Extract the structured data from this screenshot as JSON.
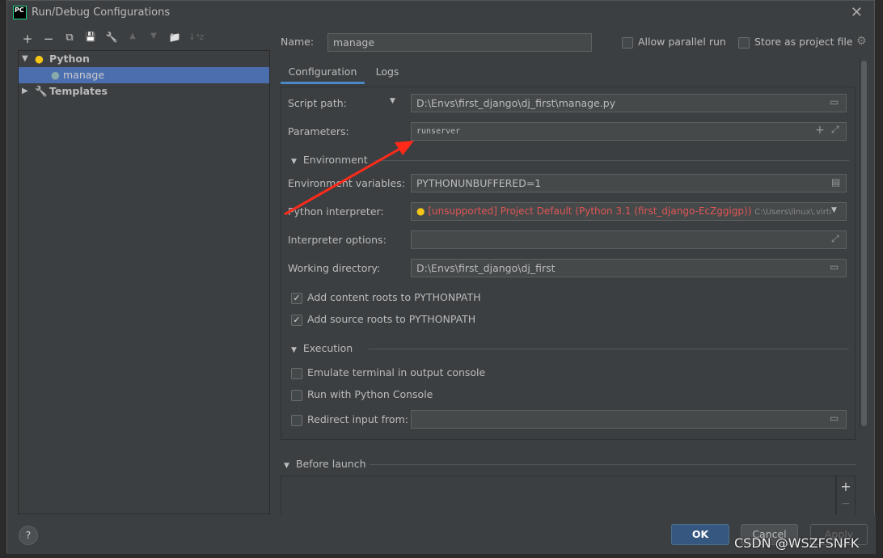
{
  "window": {
    "title": "Run/Debug Configurations",
    "logo_text": "PC"
  },
  "toolbar": {
    "add": "+",
    "remove": "−",
    "copy": "⧉",
    "save": "💾",
    "edit": "🔧",
    "up": "▲",
    "down": "▼",
    "folder": "📁",
    "sort": "↓ᵃz"
  },
  "tree": {
    "items": [
      {
        "label": "Python",
        "expanded": true
      },
      {
        "label": "manage",
        "selected": true
      },
      {
        "label": "Templates",
        "expanded": false
      }
    ]
  },
  "name": {
    "label": "Name:",
    "value": "manage"
  },
  "allow_parallel": {
    "label": "Allow parallel run",
    "checked": false
  },
  "store_project": {
    "label": "Store as project file",
    "checked": false
  },
  "tabs": [
    {
      "label": "Configuration",
      "active": true
    },
    {
      "label": "Logs",
      "active": false
    }
  ],
  "form": {
    "script_path": {
      "label": "Script path:",
      "value": "D:\\Envs\\first_django\\dj_first\\manage.py"
    },
    "parameters": {
      "label": "Parameters:",
      "value": "runserver"
    },
    "environment_section": "Environment",
    "env_vars": {
      "label": "Environment variables:",
      "value": "PYTHONUNBUFFERED=1"
    },
    "interpreter": {
      "label": "Python interpreter:",
      "value": "[unsupported] Project Default (Python 3.1 (first_django-EcZggigp))",
      "path": "C:\\Users\\linux\\.virtu"
    },
    "interp_options": {
      "label": "Interpreter options:",
      "value": ""
    },
    "working_dir": {
      "label": "Working directory:",
      "value": "D:\\Envs\\first_django\\dj_first"
    },
    "content_roots": {
      "label": "Add content roots to PYTHONPATH",
      "checked": true
    },
    "source_roots": {
      "label": "Add source roots to PYTHONPATH",
      "checked": true
    },
    "execution_section": "Execution",
    "emulate_terminal": {
      "label": "Emulate terminal in output console",
      "checked": false
    },
    "python_console": {
      "label": "Run with Python Console",
      "checked": false
    },
    "redirect_input": {
      "label": "Redirect input from:",
      "checked": false,
      "value": ""
    }
  },
  "before_launch": {
    "label": "Before launch",
    "add": "+",
    "remove": "−"
  },
  "buttons": {
    "help": "?",
    "ok": "OK",
    "cancel": "Cancel",
    "apply": "Apply"
  },
  "watermark": "CSDN @WSZFSNFK",
  "colors": {
    "accent": "#4b6eaf",
    "error": "#e05555",
    "arrow": "#ff2a1a"
  }
}
